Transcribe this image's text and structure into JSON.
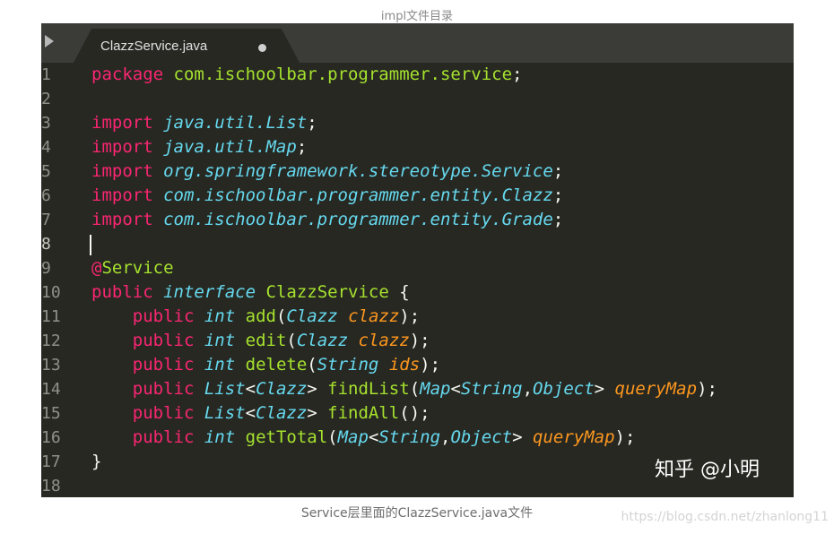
{
  "captions": {
    "top": "impl文件目录",
    "bottom": "Service层里面的ClazzService.java文件"
  },
  "editor": {
    "tab": {
      "filename": "ClazzService.java",
      "modified": true
    },
    "current_line": 8,
    "lines": [
      {
        "n": "1",
        "tokens": [
          [
            "kw",
            "package"
          ],
          [
            "plain",
            " "
          ],
          [
            "pkg",
            "com.ischoolbar.programmer.service"
          ],
          [
            "plain",
            ";"
          ]
        ]
      },
      {
        "n": "2",
        "tokens": []
      },
      {
        "n": "3",
        "tokens": [
          [
            "kw",
            "import"
          ],
          [
            "plain",
            " "
          ],
          [
            "cls",
            "java.util.List"
          ],
          [
            "plain",
            ";"
          ]
        ]
      },
      {
        "n": "4",
        "tokens": [
          [
            "kw",
            "import"
          ],
          [
            "plain",
            " "
          ],
          [
            "cls",
            "java.util.Map"
          ],
          [
            "plain",
            ";"
          ]
        ]
      },
      {
        "n": "5",
        "tokens": [
          [
            "kw",
            "import"
          ],
          [
            "plain",
            " "
          ],
          [
            "cls",
            "org.springframework.stereotype.Service"
          ],
          [
            "plain",
            ";"
          ]
        ]
      },
      {
        "n": "6",
        "tokens": [
          [
            "kw",
            "import"
          ],
          [
            "plain",
            " "
          ],
          [
            "cls",
            "com.ischoolbar.programmer.entity.Clazz"
          ],
          [
            "plain",
            ";"
          ]
        ]
      },
      {
        "n": "7",
        "tokens": [
          [
            "kw",
            "import"
          ],
          [
            "plain",
            " "
          ],
          [
            "cls",
            "com.ischoolbar.programmer.entity.Grade"
          ],
          [
            "plain",
            ";"
          ]
        ]
      },
      {
        "n": "8",
        "tokens": []
      },
      {
        "n": "9",
        "tokens": [
          [
            "kw",
            "@"
          ],
          [
            "name",
            "Service"
          ]
        ]
      },
      {
        "n": "10",
        "tokens": [
          [
            "kw",
            "public"
          ],
          [
            "plain",
            " "
          ],
          [
            "cls",
            "interface"
          ],
          [
            "plain",
            " "
          ],
          [
            "name",
            "ClazzService"
          ],
          [
            "plain",
            " {"
          ]
        ]
      },
      {
        "n": "11",
        "tokens": [
          [
            "plain",
            "    "
          ],
          [
            "kw",
            "public"
          ],
          [
            "plain",
            " "
          ],
          [
            "cls",
            "int"
          ],
          [
            "plain",
            " "
          ],
          [
            "name",
            "add"
          ],
          [
            "plain",
            "("
          ],
          [
            "cls",
            "Clazz"
          ],
          [
            "plain",
            " "
          ],
          [
            "param",
            "clazz"
          ],
          [
            "plain",
            ");"
          ]
        ]
      },
      {
        "n": "12",
        "tokens": [
          [
            "plain",
            "    "
          ],
          [
            "kw",
            "public"
          ],
          [
            "plain",
            " "
          ],
          [
            "cls",
            "int"
          ],
          [
            "plain",
            " "
          ],
          [
            "name",
            "edit"
          ],
          [
            "plain",
            "("
          ],
          [
            "cls",
            "Clazz"
          ],
          [
            "plain",
            " "
          ],
          [
            "param",
            "clazz"
          ],
          [
            "plain",
            ");"
          ]
        ]
      },
      {
        "n": "13",
        "tokens": [
          [
            "plain",
            "    "
          ],
          [
            "kw",
            "public"
          ],
          [
            "plain",
            " "
          ],
          [
            "cls",
            "int"
          ],
          [
            "plain",
            " "
          ],
          [
            "name",
            "delete"
          ],
          [
            "plain",
            "("
          ],
          [
            "cls",
            "String"
          ],
          [
            "plain",
            " "
          ],
          [
            "param",
            "ids"
          ],
          [
            "plain",
            ");"
          ]
        ]
      },
      {
        "n": "14",
        "tokens": [
          [
            "plain",
            "    "
          ],
          [
            "kw",
            "public"
          ],
          [
            "plain",
            " "
          ],
          [
            "cls",
            "List"
          ],
          [
            "plain",
            "<"
          ],
          [
            "cls",
            "Clazz"
          ],
          [
            "plain",
            "> "
          ],
          [
            "name",
            "findList"
          ],
          [
            "plain",
            "("
          ],
          [
            "cls",
            "Map"
          ],
          [
            "plain",
            "<"
          ],
          [
            "cls",
            "String"
          ],
          [
            "plain",
            ","
          ],
          [
            "cls",
            "Object"
          ],
          [
            "plain",
            "> "
          ],
          [
            "param",
            "queryMap"
          ],
          [
            "plain",
            ");"
          ]
        ]
      },
      {
        "n": "15",
        "tokens": [
          [
            "plain",
            "    "
          ],
          [
            "kw",
            "public"
          ],
          [
            "plain",
            " "
          ],
          [
            "cls",
            "List"
          ],
          [
            "plain",
            "<"
          ],
          [
            "cls",
            "Clazz"
          ],
          [
            "plain",
            "> "
          ],
          [
            "name",
            "findAll"
          ],
          [
            "plain",
            "();"
          ]
        ]
      },
      {
        "n": "16",
        "tokens": [
          [
            "plain",
            "    "
          ],
          [
            "kw",
            "public"
          ],
          [
            "plain",
            " "
          ],
          [
            "cls",
            "int"
          ],
          [
            "plain",
            " "
          ],
          [
            "name",
            "getTotal"
          ],
          [
            "plain",
            "("
          ],
          [
            "cls",
            "Map"
          ],
          [
            "plain",
            "<"
          ],
          [
            "cls",
            "String"
          ],
          [
            "plain",
            ","
          ],
          [
            "cls",
            "Object"
          ],
          [
            "plain",
            "> "
          ],
          [
            "param",
            "queryMap"
          ],
          [
            "plain",
            ");"
          ]
        ]
      },
      {
        "n": "17",
        "tokens": [
          [
            "plain",
            "}"
          ]
        ]
      },
      {
        "n": "18",
        "tokens": []
      }
    ]
  },
  "watermarks": {
    "zhihu": "知乎 @小明",
    "url": "https://blog.csdn.net/zhanlong11"
  },
  "colors": {
    "editor_bg": "#272822",
    "keyword": "#f92672",
    "type": "#66d9ef",
    "name": "#a6e22e",
    "param": "#fd971f"
  }
}
